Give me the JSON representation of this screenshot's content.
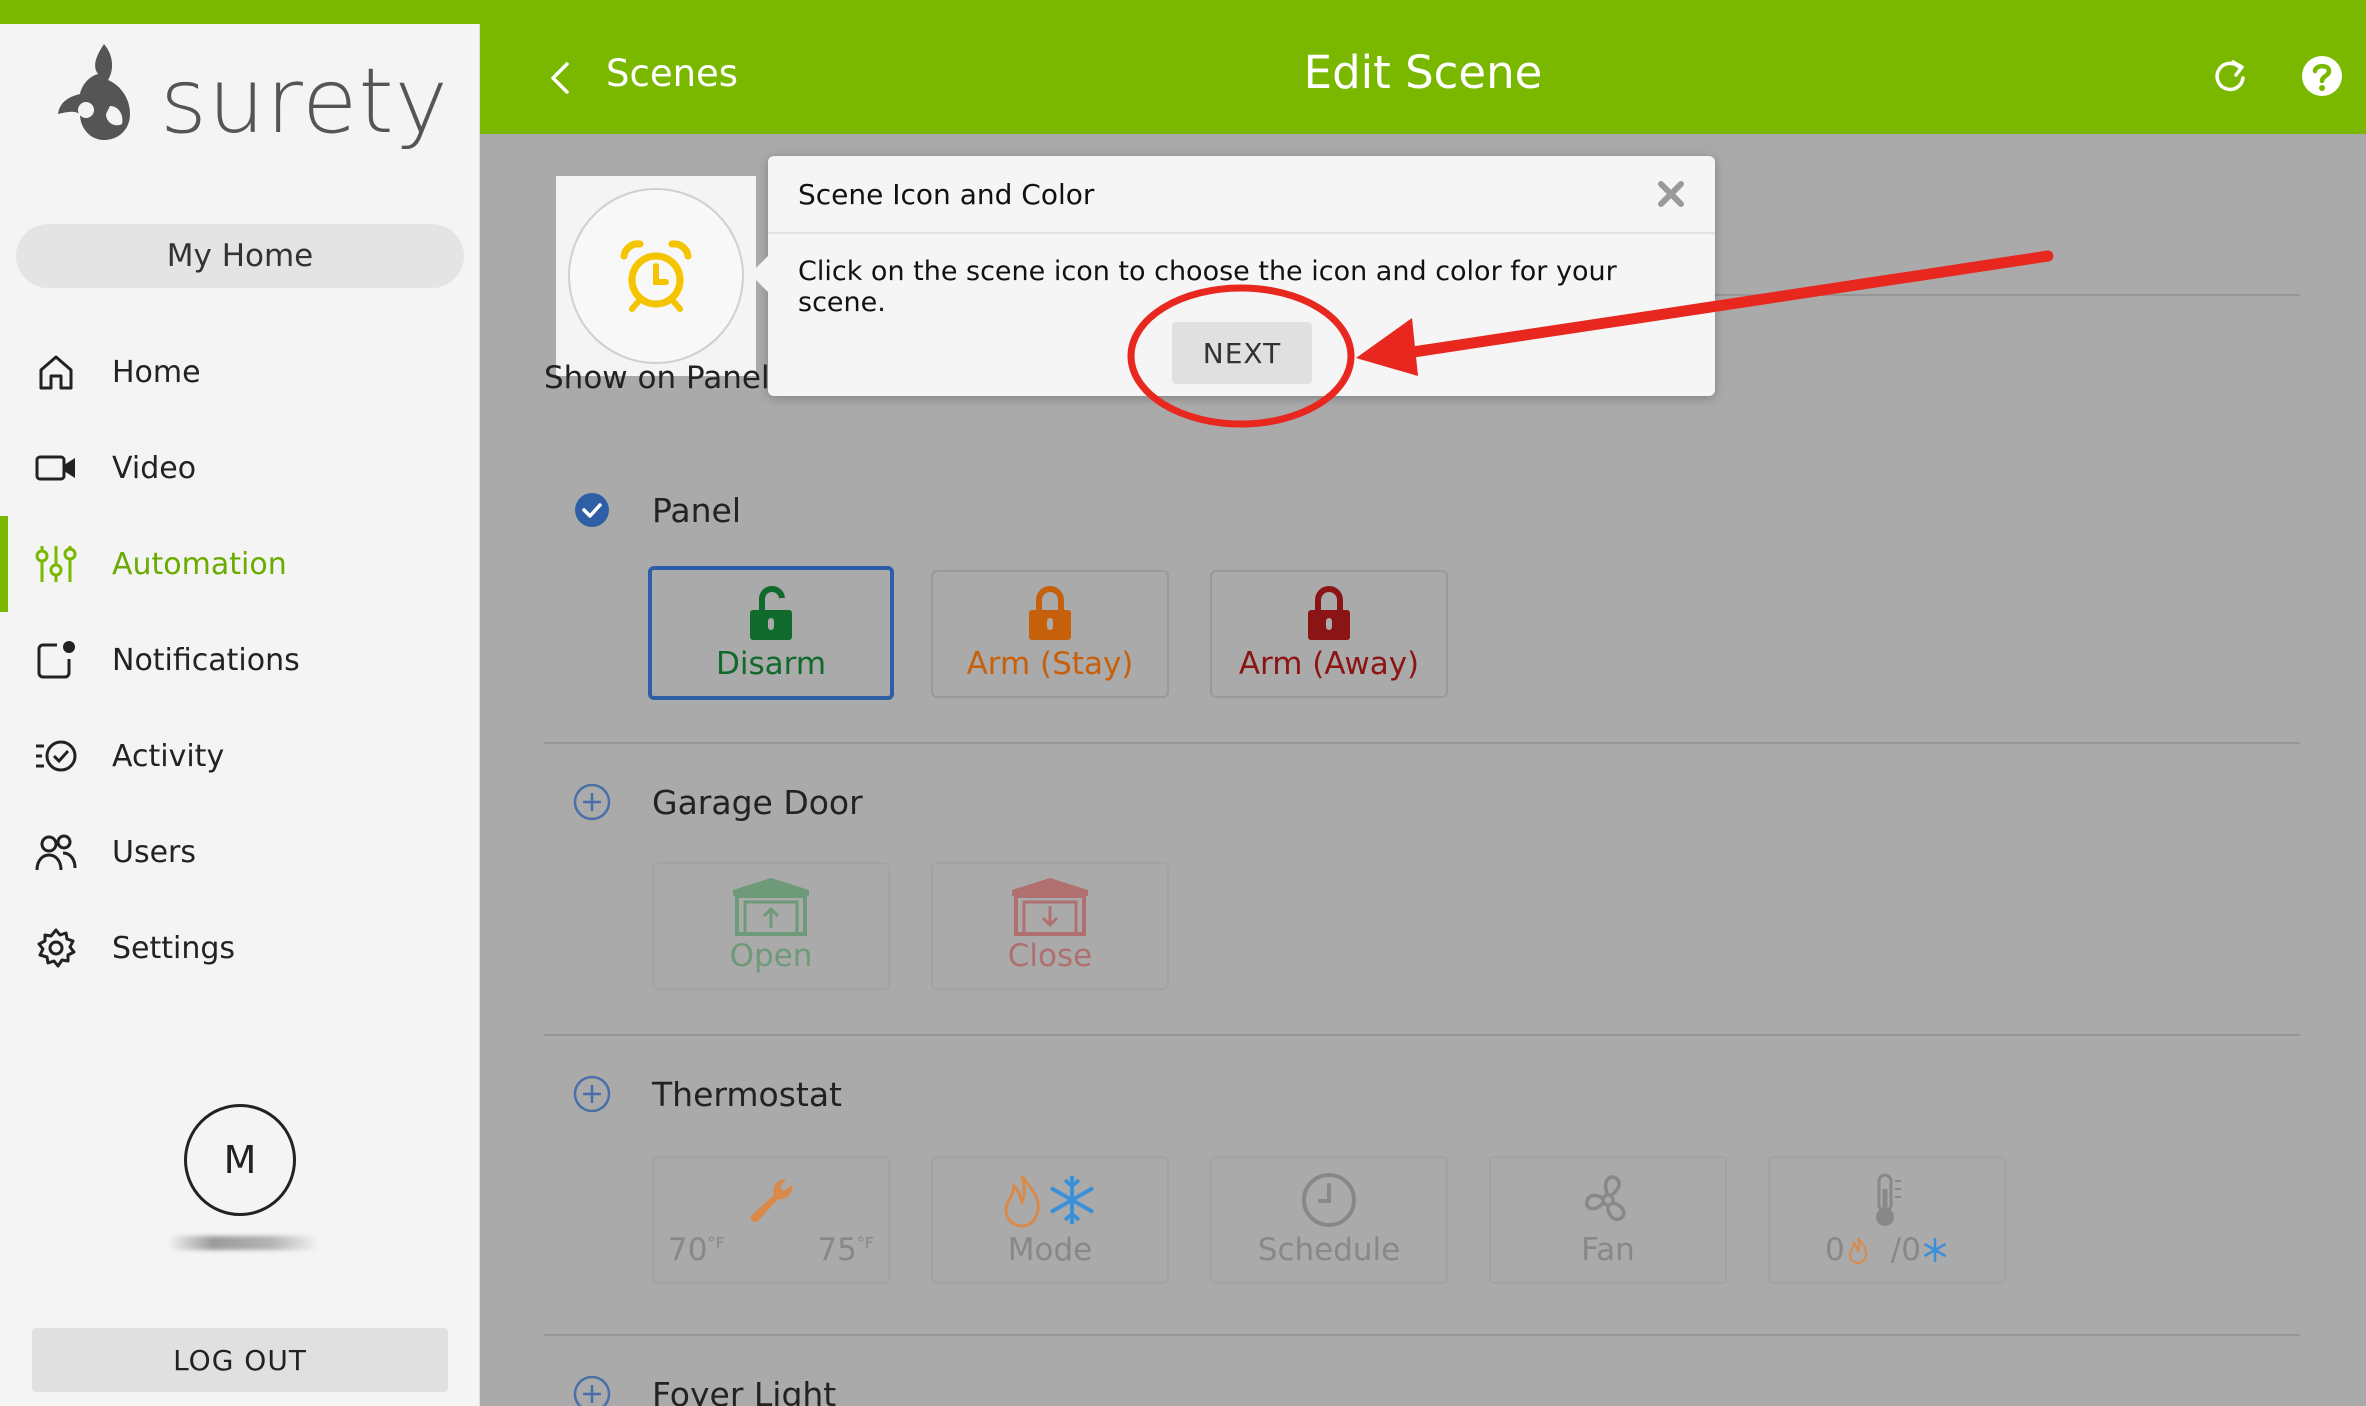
{
  "brand": {
    "name": "surety",
    "accent_color": "#7ab800",
    "active_nav_color": "#6aab00",
    "selection_color": "#2d5ea6",
    "annotation_color": "#e8271f"
  },
  "sidebar": {
    "location_label": "My Home",
    "nav": [
      {
        "label": "Home",
        "icon": "home-icon"
      },
      {
        "label": "Video",
        "icon": "video-camera-icon"
      },
      {
        "label": "Automation",
        "icon": "sliders-icon",
        "active": true
      },
      {
        "label": "Notifications",
        "icon": "notification-icon"
      },
      {
        "label": "Activity",
        "icon": "activity-icon"
      },
      {
        "label": "Users",
        "icon": "users-icon"
      },
      {
        "label": "Settings",
        "icon": "gear-icon"
      }
    ],
    "avatar_initial": "M",
    "logout_label": "LOG OUT"
  },
  "header": {
    "back_label": "Scenes",
    "title": "Edit Scene",
    "back_icon": "chevron-left-icon",
    "refresh_icon": "refresh-icon",
    "help_icon": "help-icon"
  },
  "scene": {
    "icon": "alarm-clock-icon",
    "icon_color": "#f4c400",
    "show_on_panel_label": "Show on Panel"
  },
  "sections": {
    "panel": {
      "title": "Panel",
      "checked": true,
      "actions": [
        {
          "label": "Disarm",
          "icon": "unlocked-padlock-icon",
          "color": "#0f6a2c",
          "selected": true
        },
        {
          "label": "Arm (Stay)",
          "icon": "padlock-icon",
          "color": "#c7600a"
        },
        {
          "label": "Arm (Away)",
          "icon": "padlock-icon",
          "color": "#8b1414"
        }
      ]
    },
    "garage": {
      "title": "Garage Door",
      "actions": [
        {
          "label": "Open",
          "icon": "garage-open-icon",
          "color": "#6f9a7a"
        },
        {
          "label": "Close",
          "icon": "garage-close-icon",
          "color": "#b07070"
        }
      ]
    },
    "thermostat": {
      "title": "Thermostat",
      "setpoint_heat": "70",
      "setpoint_cool": "75",
      "unit": "°F",
      "mode_label": "Mode",
      "schedule_label": "Schedule",
      "fan_label": "Fan",
      "offset_heat": "0",
      "offset_cool": "/0"
    },
    "foyer": {
      "title": "Foyer Light"
    }
  },
  "popover": {
    "title": "Scene Icon and Color",
    "body": "Click on the scene icon to choose the icon and color for your scene.",
    "next_label": "NEXT",
    "close_icon": "close-icon"
  }
}
